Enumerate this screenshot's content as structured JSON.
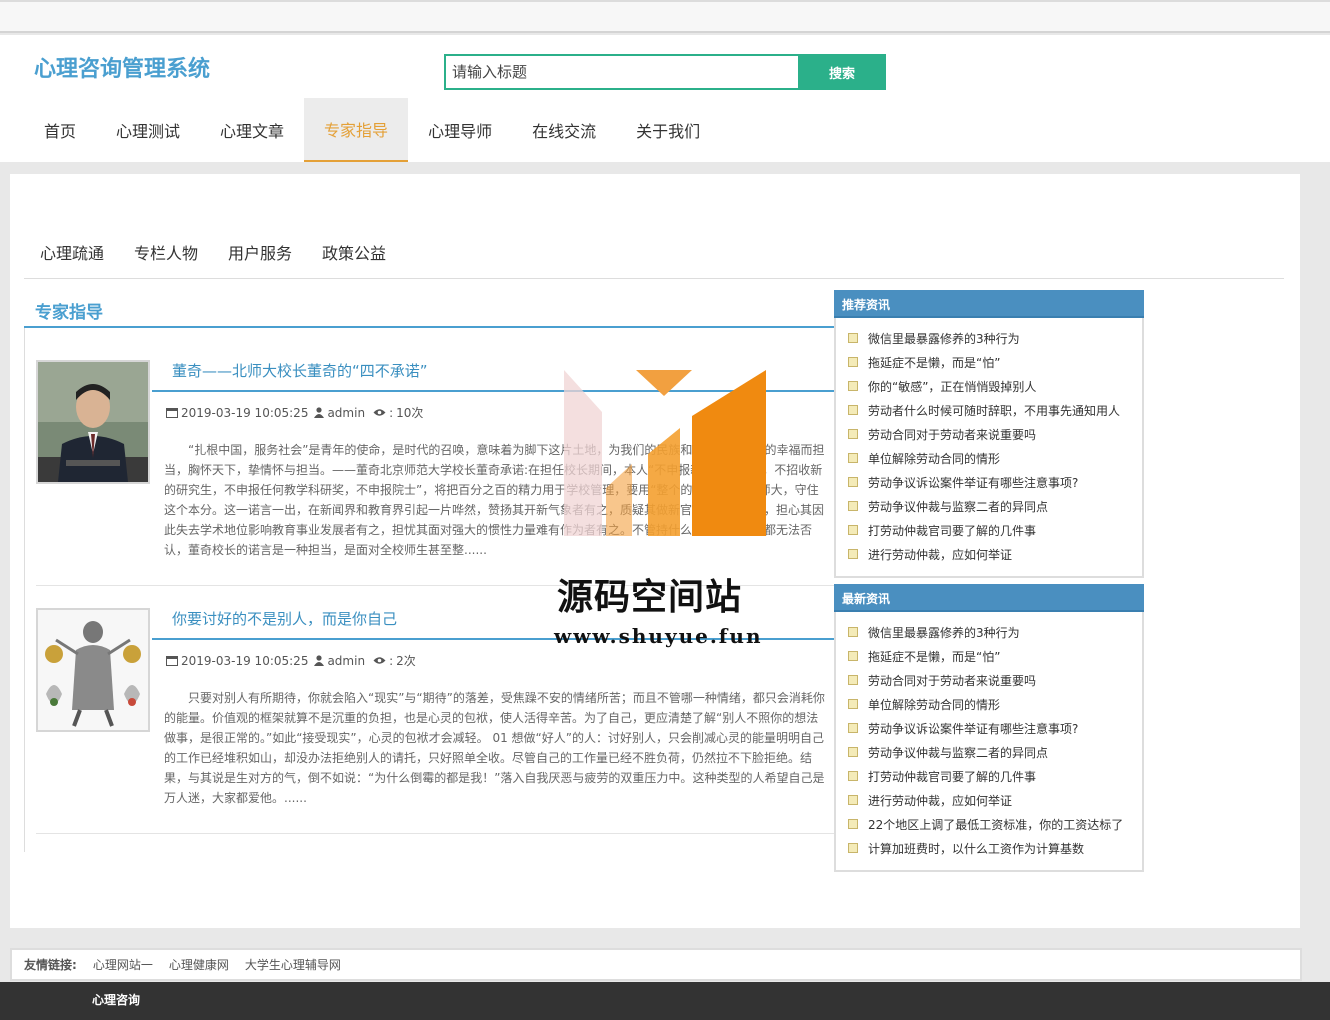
{
  "header": {
    "logo": "心理咨询管理系统",
    "search_placeholder": "请输入标题",
    "search_button": "搜索"
  },
  "nav": [
    {
      "label": "首页",
      "active": false
    },
    {
      "label": "心理测试",
      "active": false
    },
    {
      "label": "心理文章",
      "active": false
    },
    {
      "label": "专家指导",
      "active": true
    },
    {
      "label": "心理导师",
      "active": false
    },
    {
      "label": "在线交流",
      "active": false
    },
    {
      "label": "关于我们",
      "active": false
    }
  ],
  "subnav": [
    "心理疏通",
    "专栏人物",
    "用户服务",
    "政策公益"
  ],
  "section_title": "专家指导",
  "articles": [
    {
      "title": "董奇——北师大校长董奇的“四不承诺”",
      "date": "2019-03-19 10:05:25",
      "author": "admin",
      "views": "10次",
      "summary": "“扎根中国，服务社会”是青年的使命，是时代的召唤，意味着为脚下这片土地，为我们的民族和国家，为人民的幸福而担当，胸怀天下，挚情怀与担当。——董奇北京师范大学校长董奇承诺:在担任校长期间，本人“不申报新的科研课题，不招收新的研究生，不申报任何教学科研奖，不申报院士”，将把百分之百的精力用于学校管理，要用“整个的心”去办好北师大，守住这个本分。这一诺言一出，在新闻界和教育界引起一片哗然，赞扬其开新气象者有之，质疑其做新官上任秀者有之，担心其因此失去学术地位影响教育事业发展者有之，担忧其面对强大的惯性力量难有作为者有之。不管持什么观点和态度者都无法否认，董奇校长的诺言是一种担当，是面对全校师生甚至整......"
    },
    {
      "title": "你要讨好的不是别人，而是你自己",
      "date": "2019-03-19 10:05:25",
      "author": "admin",
      "views": "2次",
      "summary": "只要对别人有所期待，你就会陷入“现实”与“期待”的落差，受焦躁不安的情绪所苦；而且不管哪一种情绪，都只会消耗你的能量。价值观的框架就算不是沉重的负担，也是心灵的包袱，使人活得辛苦。为了自己，更应清楚了解“别人不照你的想法做事，是很正常的。”如此“接受现实”，心灵的包袱才会减轻。 01 想做“好人”的人：讨好别人，只会削减心灵的能量明明自己的工作已经堆积如山，却没办法拒绝别人的请托，只好照单全收。尽管自己的工作量已经不胜负荷，仍然拉不下脸拒绝。结果，与其说是生对方的气，倒不如说：“为什么倒霉的都是我！”落入自我厌恶与疲劳的双重压力中。这种类型的人希望自己是万人迷，大家都爱他。......"
    }
  ],
  "sidebar": {
    "recommended": {
      "title": "推荐资讯",
      "items": [
        "微信里最暴露修养的3种行为",
        "拖延症不是懒，而是“怕”",
        "你的“敏感”，正在悄悄毁掉别人",
        "劳动者什么时候可随时辞职，不用事先通知用人",
        "劳动合同对于劳动者来说重要吗",
        "单位解除劳动合同的情形",
        "劳动争议诉讼案件举证有哪些注意事项?",
        "劳动争议仲裁与监察二者的异同点",
        "打劳动仲裁官司要了解的几件事",
        "进行劳动仲裁，应如何举证"
      ]
    },
    "latest": {
      "title": "最新资讯",
      "items": [
        "微信里最暴露修养的3种行为",
        "拖延症不是懒，而是“怕”",
        "劳动合同对于劳动者来说重要吗",
        "单位解除劳动合同的情形",
        "劳动争议诉讼案件举证有哪些注意事项?",
        "劳动争议仲裁与监察二者的异同点",
        "打劳动仲裁官司要了解的几件事",
        "进行劳动仲裁，应如何举证",
        "22个地区上调了最低工资标准，你的工资达标了",
        "计算加班费时，以什么工资作为计算基数"
      ]
    }
  },
  "friend_links": {
    "label": "友情链接:",
    "items": [
      "心理网站一",
      "心理健康网",
      "大学生心理辅导网"
    ]
  },
  "footer": "心理咨询",
  "watermark": {
    "line1": "源码空间站",
    "line2": "www.shuyue.fun"
  },
  "colors": {
    "accent_blue": "#4a9fd0",
    "search_green": "#2bb08a",
    "active_orange": "#e4a037",
    "footer_dark": "#333333"
  }
}
